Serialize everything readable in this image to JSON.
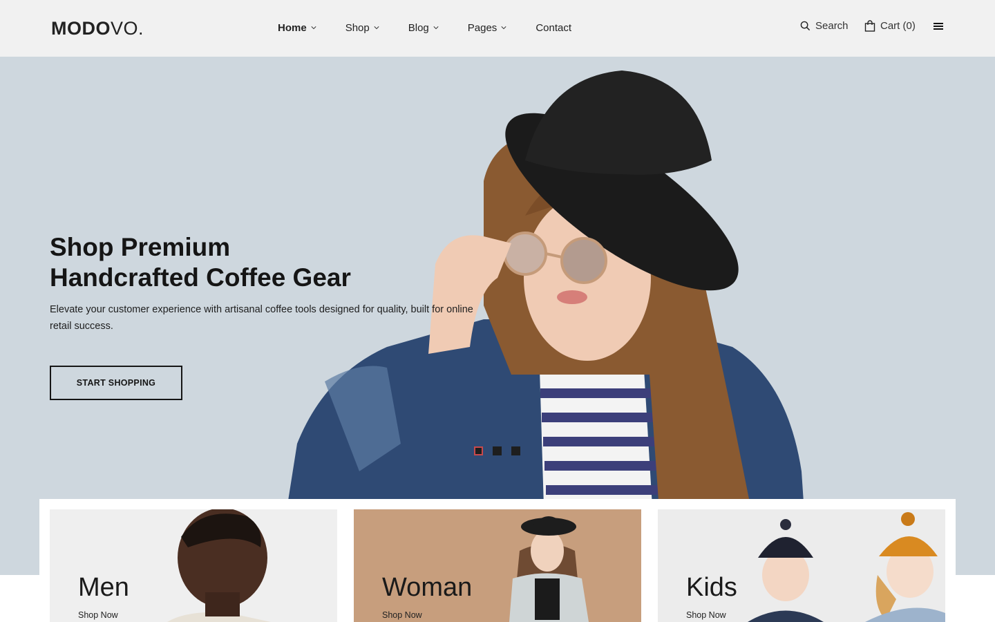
{
  "brand": {
    "logo_bold": "MODO",
    "logo_thin": "VO."
  },
  "nav": {
    "items": [
      {
        "label": "Home",
        "has_dropdown": true,
        "active": true
      },
      {
        "label": "Shop",
        "has_dropdown": true,
        "active": false
      },
      {
        "label": "Blog",
        "has_dropdown": true,
        "active": false
      },
      {
        "label": "Pages",
        "has_dropdown": true,
        "active": false
      },
      {
        "label": "Contact",
        "has_dropdown": false,
        "active": false
      }
    ]
  },
  "utilities": {
    "search_label": "Search",
    "cart_label": "Cart (0)",
    "search_icon": "search-icon",
    "cart_icon": "shopping-bag-icon",
    "menu_icon": "hamburger-menu-icon"
  },
  "hero": {
    "title_line1": "Shop Premium",
    "title_line2": "Handcrafted Coffee Gear",
    "subtitle": "Elevate your customer experience with artisanal coffee tools designed for quality, built for online retail success.",
    "cta_label": "START SHOPPING",
    "slides_total": 3,
    "active_slide": 1
  },
  "categories": [
    {
      "title": "Men",
      "link": "Shop Now"
    },
    {
      "title": "Woman",
      "link": "Shop Now"
    },
    {
      "title": "Kids",
      "link": "Shop Now"
    }
  ],
  "colors": {
    "header_bg": "#f1f1f1",
    "hero_bg": "#ced7de",
    "text": "#151515",
    "active_dot_border": "#c9494c",
    "woman_card_bg": "#c79e7d"
  }
}
